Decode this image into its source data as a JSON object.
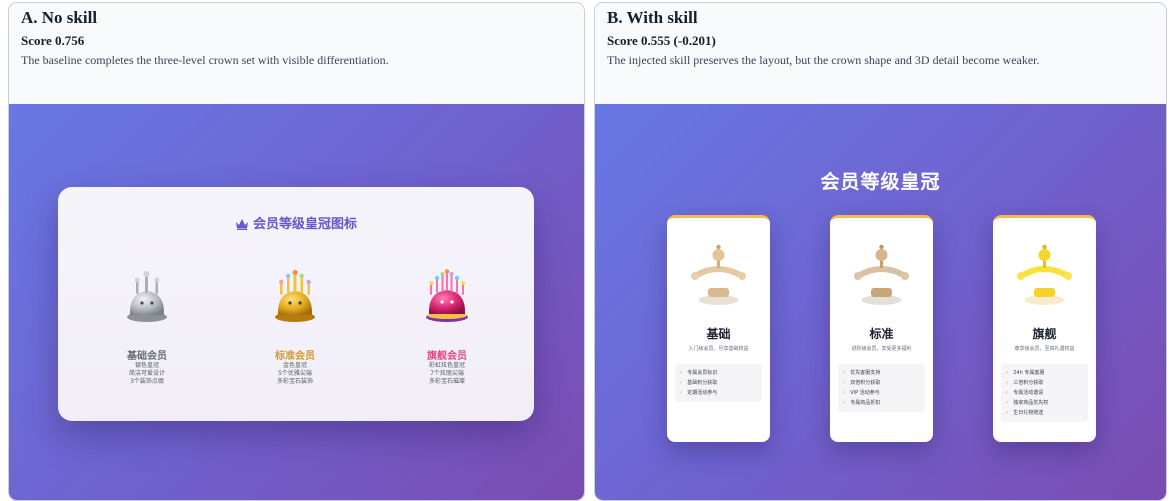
{
  "panels": {
    "a": {
      "title": "A. No skill",
      "score": "Score 0.756",
      "description": "The baseline completes the three-level crown set with visible differentiation.",
      "screenshot": {
        "card_title": "会员等级皇冠图标",
        "tiers": [
          {
            "name": "基础会员",
            "lines": [
              "银色皇冠",
              "简洁可爱设计",
              "3个装饰点缀"
            ],
            "color": "#6b6f77"
          },
          {
            "name": "标准会员",
            "lines": [
              "金色皇冠",
              "5个优雅尖端",
              "多彩宝石装饰"
            ],
            "color": "#d69a2c"
          },
          {
            "name": "旗舰会员",
            "lines": [
              "彩虹炫色皇冠",
              "7个炫丽尖端",
              "多彩宝石璀璨"
            ],
            "color": "#e24d8a"
          }
        ]
      }
    },
    "b": {
      "title": "B. With skill",
      "score": "Score 0.555 (-0.201)",
      "description": "The injected skill preserves the layout, but the crown shape and 3D detail become weaker.",
      "screenshot": {
        "heading": "会员等级皇冠",
        "tiers": [
          {
            "name": "基础",
            "desc": "入门级会员，尽享基础权益",
            "features": [
              "专属会员标识",
              "基础积分获取",
              "定期活动参与"
            ]
          },
          {
            "name": "标准",
            "desc": "进阶级会员，享受更多福利",
            "features": [
              "优先客服支持",
              "双倍积分获取",
              "VIP 活动参与",
              "专属商品折扣"
            ]
          },
          {
            "name": "旗舰",
            "desc": "尊享级会员，至高礼遇权益",
            "features": [
              "24h 专属客服",
              "三倍积分获取",
              "专属活动邀请",
              "独家商品优先权",
              "生日礼物赠送"
            ]
          }
        ]
      }
    }
  },
  "colors": {
    "gradient_start": "#6878e4",
    "gradient_end": "#7a4cb0",
    "accent_purple": "#6a56c8",
    "gold": "#e7a734",
    "silver": "#9a9ea6",
    "magenta": "#e24d8a"
  }
}
